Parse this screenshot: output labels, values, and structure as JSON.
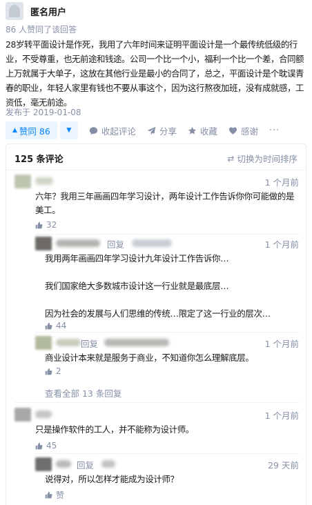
{
  "author": {
    "name": "匿名用户"
  },
  "answer": {
    "vote_summary": "86 人赞同了该回答",
    "body": "28岁转平面设计是作死，我用了六年时间来证明平面设计是一个最传统低级的行业，不受尊重，也无前途和钱途。公司一个比一个小，福利一个比一个差，合同额上万就属于大单子，这放在其他行业是最小的合同了，总之，平面设计是个耽误青春的职业，年轻人家里有钱也不要从事这个，因为这行熬夜加班，没有成就感，工资低，毫无前途。",
    "publish_date": "发布于 2019-01-08"
  },
  "actions": {
    "vote": "赞同 86",
    "collapse_comments": "收起评论",
    "share": "分享",
    "collect": "收藏",
    "thanks": "感谢",
    "more": "···"
  },
  "comments": {
    "count_label": "125 条评论",
    "sort_toggle": "切换为时间排序",
    "items": [
      {
        "time": "1 个月前",
        "text": "六年？我用三年画画四年学习设计，两年设计工作告诉你你可能做的是美工。",
        "likes": "32"
      },
      {
        "reply_word": "回复",
        "time": "1 个月前",
        "text": "我用两年画画四年学习设计九年设计工作告诉你…\n\n我们国家绝大多数城市设计这一行业就是最底层…\n\n因为社会的发展与人们思维的传统…限定了这一行业的层次…",
        "likes": "44"
      },
      {
        "reply_word": "回复",
        "time": "1 个月前",
        "text": "商业设计本来就是服务于商业，不知道你怎么理解底层。",
        "likes": "2"
      },
      {
        "time": "1 个月前",
        "text": "只是操作软件的工人，并不能称为设计师。",
        "likes": "45"
      },
      {
        "reply_word": "回复",
        "time": "29 天前",
        "text": "说得对，所以怎样才能成为设计师？",
        "likes": "赞"
      }
    ],
    "view_all": "查看全部 13 条回复"
  }
}
